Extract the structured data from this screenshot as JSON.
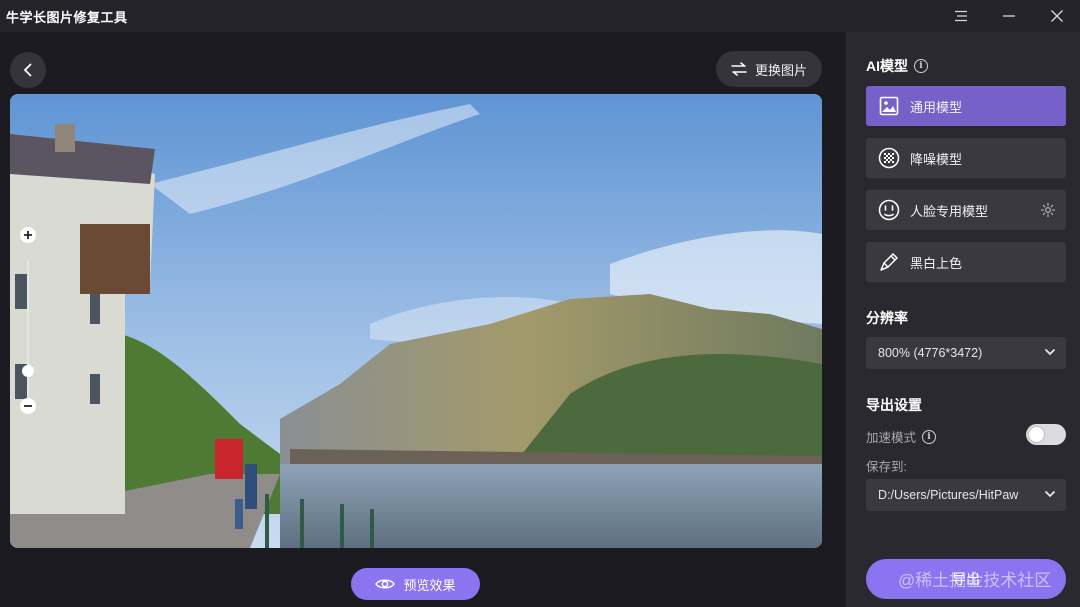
{
  "app": {
    "title": "牛学长图片修复工具"
  },
  "window_controls": {
    "menu_icon": "menu-icon",
    "minimize_icon": "minimize-icon",
    "close_icon": "close-icon"
  },
  "toolbar": {
    "swap_label": "更换图片",
    "preview_label": "预览效果"
  },
  "panel": {
    "ai_section_title": "AI模型",
    "models": [
      {
        "label": "通用模型",
        "icon": "image-icon",
        "active": true
      },
      {
        "label": "降噪模型",
        "icon": "denoise-icon",
        "active": false
      },
      {
        "label": "人脸专用模型",
        "icon": "face-icon",
        "active": false
      },
      {
        "label": "黑白上色",
        "icon": "colorize-icon",
        "active": false
      }
    ],
    "resolution_title": "分辨率",
    "resolution_value": "800% (4776*3472)",
    "export_title": "导出设置",
    "accelerate_label": "加速模式",
    "accelerate_on": false,
    "save_to_label": "保存到:",
    "save_path": "D:/Users/Pictures/HitPaw",
    "export_button": "导出"
  },
  "watermark": "@稀土掘金技术社区",
  "colors": {
    "accent": "#8b74f0",
    "active_model": "#7661c8",
    "panel_bg": "#2a2930",
    "canvas_bg": "#1c1b22"
  }
}
